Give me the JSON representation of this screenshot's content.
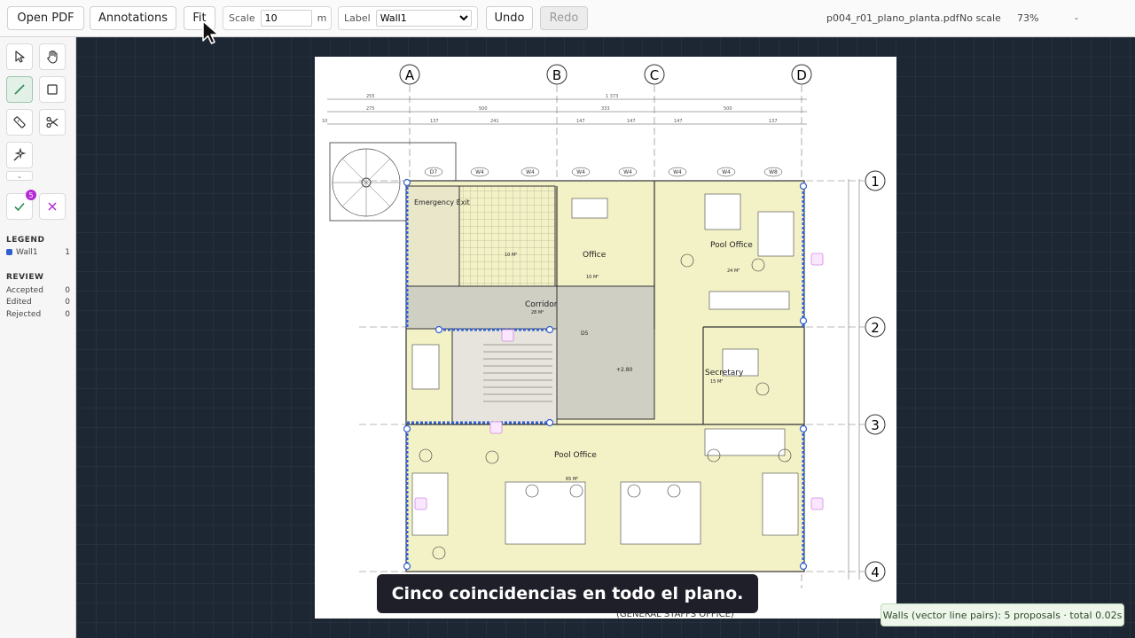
{
  "toolbar": {
    "open_pdf": "Open PDF",
    "annotations": "Annotations",
    "fit": "Fit",
    "scale_label": "Scale",
    "scale_value": "10",
    "scale_unit": "m",
    "label_label": "Label",
    "label_selected": "Wall1",
    "undo": "Undo",
    "redo": "Redo",
    "file_name": "p004_r01_plano_planta.pdf",
    "scale_status": "No scale",
    "zoom": "73%",
    "dash": "-"
  },
  "sidebar": {
    "pending_count": "5",
    "legend_title": "LEGEND",
    "legend_items": [
      {
        "label": "Wall1",
        "count": "1",
        "color": "#2f5fd0"
      }
    ],
    "review_title": "REVIEW",
    "review": [
      {
        "label": "Accepted",
        "count": "0"
      },
      {
        "label": "Edited",
        "count": "0"
      },
      {
        "label": "Rejected",
        "count": "0"
      }
    ]
  },
  "plan": {
    "axes": [
      "A",
      "B",
      "C",
      "D"
    ],
    "rows": [
      "1",
      "2",
      "3",
      "4"
    ],
    "dims_top": [
      "255",
      "1 373",
      "275",
      "500",
      "333",
      "500"
    ],
    "dims_bottom": [
      "10",
      "137",
      "241",
      "147",
      "147",
      "147",
      "137"
    ],
    "door_tags": [
      "D7",
      "W4",
      "W4",
      "W4",
      "W4",
      "W4",
      "W4",
      "W8"
    ],
    "rooms": {
      "emergency": "Emergency Exit",
      "office": "Office",
      "office_area": "10 M²",
      "pool_top": "Pool Office",
      "pool_top_area": "24 M²",
      "corridor": "Corridor",
      "corridor_area": "28 M²",
      "secretary": "Secretary",
      "secretary_area": "15 M²",
      "pool_bottom": "Pool Office",
      "pool_bottom_area": "65 M²",
      "wc_area": "10 M²",
      "elev": "+2.80",
      "tag_d5": "D5"
    },
    "footer_text": "(GENERAL STAFFS OFFICE)"
  },
  "caption": "Cinco coincidencias en todo el plano.",
  "toast": "Walls (vector line pairs): 5 proposals · total 0.02s",
  "colors": {
    "accent": "#2f5fd0",
    "pending": "#b42bd6",
    "room_fill": "#f3f1c6"
  }
}
